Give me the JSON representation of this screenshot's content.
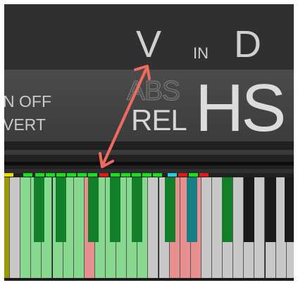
{
  "header": {
    "mode_letter": "V",
    "in_label": "IN",
    "key_letter": "D"
  },
  "options": {
    "off_label": "N OFF",
    "vert_label": "VERT"
  },
  "display": {
    "abs_label": "ABS",
    "rel_label": "REL",
    "big_label": "HS"
  },
  "keyboard": {
    "white_keys": [
      {
        "color": "#9a9a00"
      },
      {
        "color": "#c8c8c8"
      },
      {
        "color": "#86d98f"
      },
      {
        "color": "#86d98f"
      },
      {
        "color": "#86d98f"
      },
      {
        "color": "#86d98f"
      },
      {
        "color": "#86d98f"
      },
      {
        "color": "#86d98f"
      },
      {
        "color": "#e88f8f"
      },
      {
        "color": "#86d98f"
      },
      {
        "color": "#86d98f"
      },
      {
        "color": "#86d98f"
      },
      {
        "color": "#86d98f"
      },
      {
        "color": "#86d98f"
      },
      {
        "color": "#c8c8c8"
      },
      {
        "color": "#c8c8c8"
      },
      {
        "color": "#e88f8f"
      },
      {
        "color": "#e88f8f"
      },
      {
        "color": "#e88f8f"
      },
      {
        "color": "#c8c8c8"
      },
      {
        "color": "#c8c8c8"
      },
      {
        "color": "#c8c8c8"
      },
      {
        "color": "#c8c8c8"
      },
      {
        "color": "#c8c8c8"
      },
      {
        "color": "#c8c8c8"
      },
      {
        "color": "#c8c8c8"
      },
      {
        "color": "#c8c8c8"
      },
      {
        "color": "#c8c8c8"
      }
    ],
    "black_keys": [
      {
        "color": "#137f2a"
      },
      {
        "color": "#137f2a"
      },
      {
        "color": "#137f2a"
      },
      {
        "color": "#137f2a"
      },
      {
        "color": "#137f2a"
      },
      {
        "color": "#137f2a"
      },
      {
        "color": "#187f84"
      },
      {
        "color": "#137f2a"
      },
      {
        "color": "#1a1a1a"
      },
      {
        "color": "#1a1a1a"
      },
      {
        "color": "#1a1a1a"
      },
      {
        "color": "#1a1a1a"
      },
      {
        "color": "#1a1a1a"
      }
    ],
    "leds": [
      {
        "color": "#e8e000"
      },
      {
        "color": "#18e018"
      },
      {
        "color": "#18e018"
      },
      {
        "color": "#18e018"
      },
      {
        "color": "#18e018"
      },
      {
        "color": "#18e018"
      },
      {
        "color": "#18e018"
      },
      {
        "color": "#18e018"
      },
      {
        "color": "#e01818"
      },
      {
        "color": "#18e018"
      },
      {
        "color": "#18e018"
      },
      {
        "color": "#18e018"
      },
      {
        "color": "#18e018"
      },
      {
        "color": "#18e018"
      },
      {
        "color": "#30c8e0"
      },
      {
        "color": "#e01818"
      },
      {
        "color": "#18e018"
      },
      {
        "color": "#e01818"
      }
    ]
  },
  "colors": {
    "arrow": "#f06a5e"
  }
}
